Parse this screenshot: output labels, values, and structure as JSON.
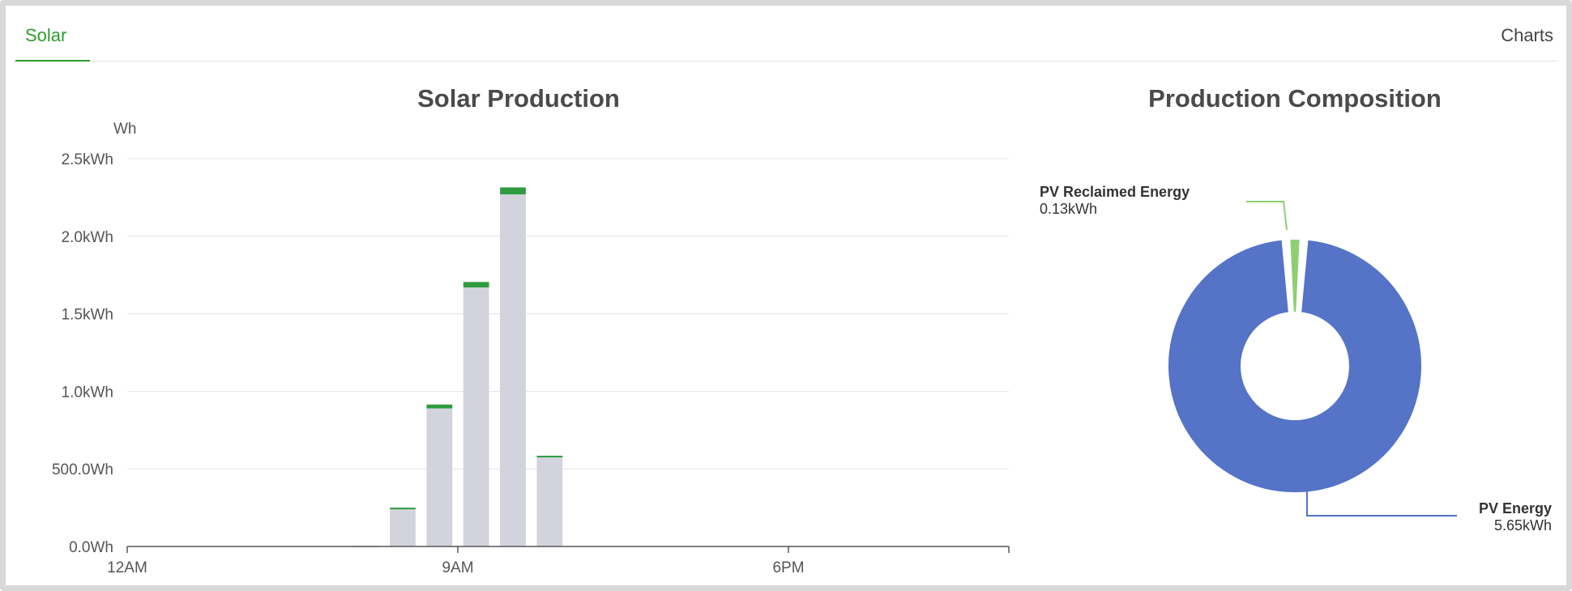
{
  "tabs": {
    "active_label": "Solar",
    "charts_link": "Charts"
  },
  "chart_data": [
    {
      "type": "bar",
      "title": "Solar Production",
      "ylabel": "Wh",
      "ylim": [
        0,
        2500
      ],
      "yticks": [
        {
          "value": 0,
          "label": "0.0Wh"
        },
        {
          "value": 500,
          "label": "500.0Wh"
        },
        {
          "value": 1000,
          "label": "1.0kWh"
        },
        {
          "value": 1500,
          "label": "1.5kWh"
        },
        {
          "value": 2000,
          "label": "2.0kWh"
        },
        {
          "value": 2500,
          "label": "2.5kWh"
        }
      ],
      "xticks": [
        {
          "hour": 0,
          "label": "12AM"
        },
        {
          "hour": 9,
          "label": "9AM"
        },
        {
          "hour": 18,
          "label": "6PM"
        }
      ],
      "categories": [
        0,
        1,
        2,
        3,
        4,
        5,
        6,
        7,
        8,
        9,
        10,
        11,
        12,
        13,
        14,
        15,
        16,
        17,
        18,
        19,
        20,
        21,
        22,
        23
      ],
      "series": [
        {
          "values": [
            0,
            0,
            0,
            0,
            0,
            0,
            5,
            240,
            890,
            1670,
            2270,
            575,
            0,
            0,
            0,
            0,
            0,
            0,
            0,
            0,
            0,
            0,
            0,
            0
          ]
        },
        {
          "values": [
            0,
            0,
            0,
            0,
            0,
            0,
            0,
            10,
            25,
            35,
            45,
            10,
            0,
            0,
            0,
            0,
            0,
            0,
            0,
            0,
            0,
            0,
            0,
            0
          ]
        }
      ],
      "colors": [
        "#d2d3dd",
        "#2e9c3e"
      ],
      "grid": true
    },
    {
      "type": "pie",
      "title": "Production Composition",
      "slices": [
        {
          "label": "PV Reclaimed Energy",
          "value_label": "0.13kWh",
          "value": 0.13,
          "color": "#8ecf72"
        },
        {
          "label": "PV Energy",
          "value_label": "5.65kWh",
          "value": 5.65,
          "color": "#5573c7"
        }
      ]
    }
  ]
}
